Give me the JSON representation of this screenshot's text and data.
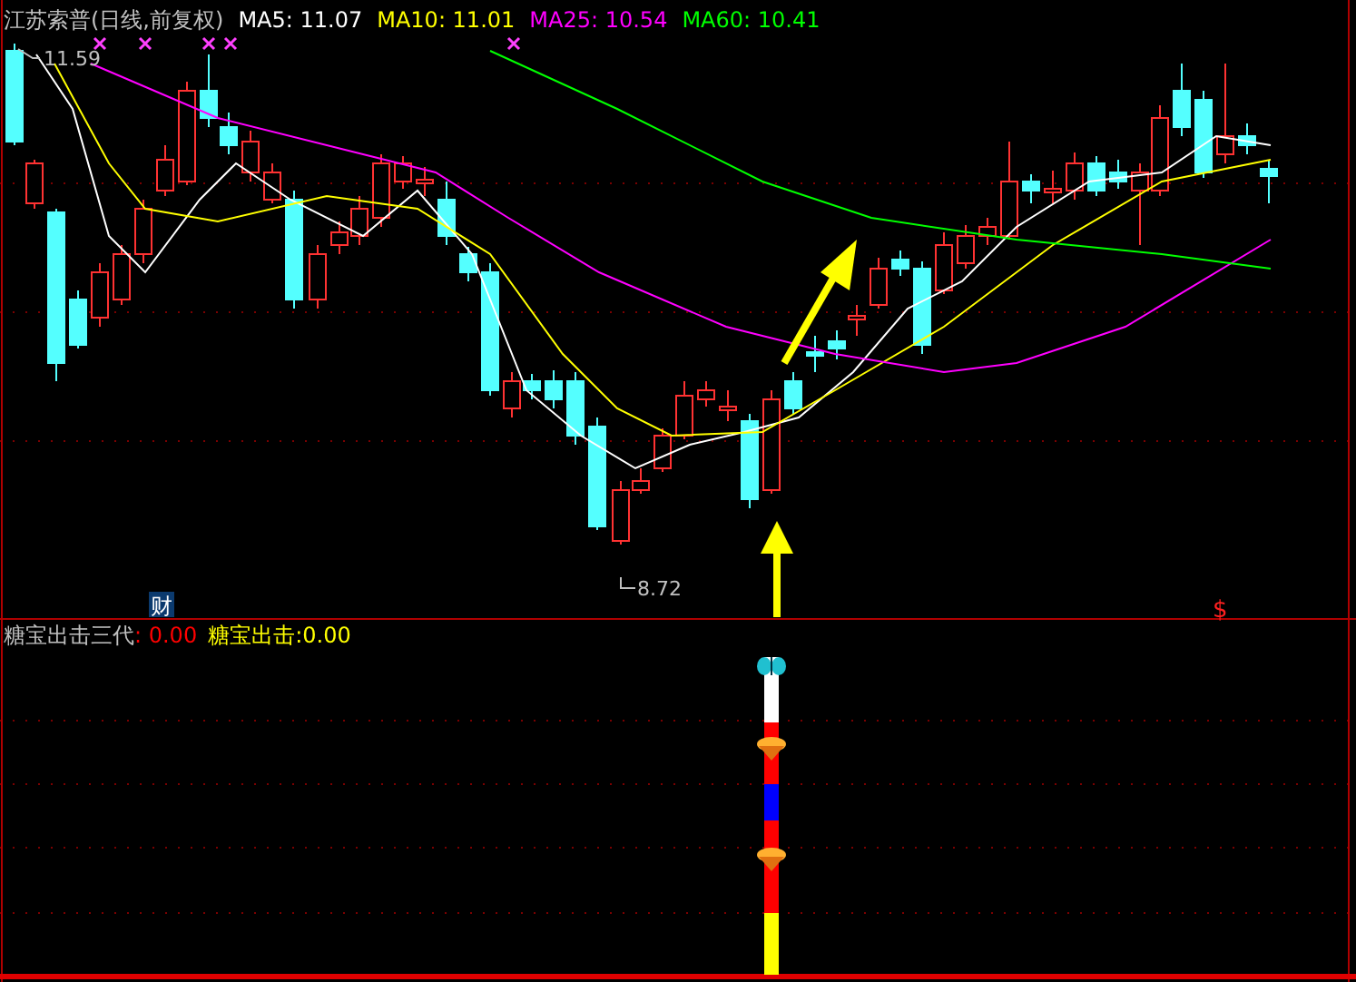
{
  "chart_title": "江苏索普(日线,前复权)",
  "moving_averages": [
    {
      "text": "MA5: 11.07",
      "color": "#ffffff"
    },
    {
      "text": "MA10: 11.01",
      "color": "#ffff00"
    },
    {
      "text": "MA25: 10.54",
      "color": "#ff00ff"
    },
    {
      "text": "MA60: 10.41",
      "color": "#00ff00"
    }
  ],
  "high_marker": "11.59",
  "low_marker": "8.72",
  "finance_badge": "财",
  "dividend_marker": "$",
  "lower_panel": {
    "indicators": [
      {
        "text": "糖宝出击三代",
        "color": "#c0c0c0"
      },
      {
        "text": ": 0.00",
        "color": "#ff0000"
      },
      {
        "text": "糖宝出击:",
        "color": "#ffff00"
      },
      {
        "text": "0.00",
        "color": "#ffff00"
      }
    ]
  }
}
